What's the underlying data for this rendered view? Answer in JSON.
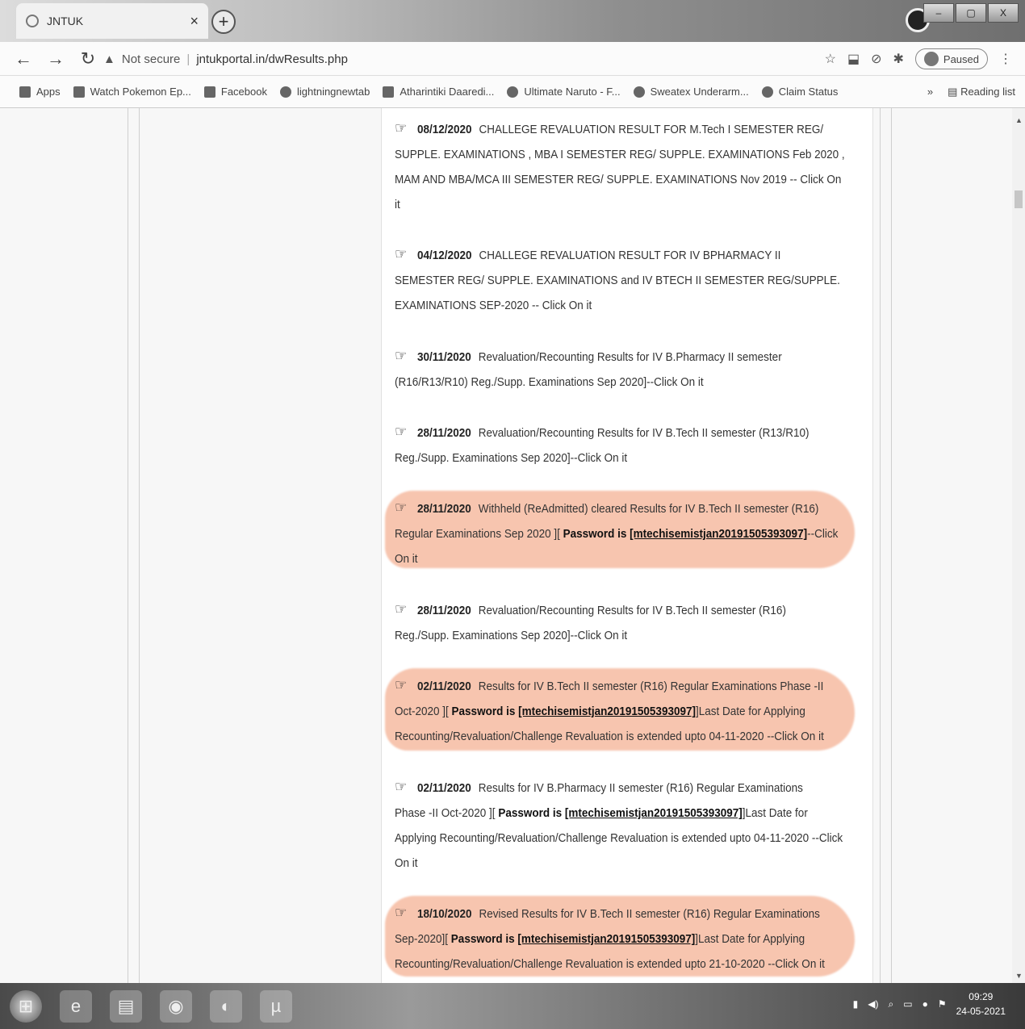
{
  "browser": {
    "tab_title": "JNTUK",
    "tab_close": "×",
    "new_tab": "+",
    "window_buttons": [
      "–",
      "▢",
      "X"
    ],
    "address_warning": "Not secure",
    "url": "jntukportal.in/dwResults.php",
    "profile_status": "Paused",
    "menu": "⋮"
  },
  "bookmarks": {
    "items": [
      {
        "label": "Apps",
        "icon": "apps-grid-icon"
      },
      {
        "label": "Watch Pokemon Ep...",
        "icon": "site-icon"
      },
      {
        "label": "Facebook",
        "icon": "facebook-icon"
      },
      {
        "label": "lightningnewtab",
        "icon": "globe-icon"
      },
      {
        "label": "Atharintiki Daaredi...",
        "icon": "site-icon"
      },
      {
        "label": "Ultimate Naruto - F...",
        "icon": "site-icon"
      },
      {
        "label": "Sweatex Underarm...",
        "icon": "globe-icon"
      },
      {
        "label": "Claim Status",
        "icon": "globe-icon"
      }
    ],
    "overflow": "»",
    "reading_list": "Reading list"
  },
  "results": [
    {
      "date": "08/12/2020",
      "text_lines": [
        "CHALLEGE REVALUATION RESULT FOR M.Tech I SEMESTER REG/",
        "SUPPLE. EXAMINATIONS , MBA I SEMESTER REG/ SUPPLE. EXAMINATIONS Feb 2020 ,",
        "MAM AND MBA/MCA III SEMESTER REG/ SUPPLE. EXAMINATIONS Nov 2019 -- Click On",
        "it"
      ]
    },
    {
      "date": "04/12/2020",
      "text_lines": [
        "CHALLEGE REVALUATION RESULT FOR IV BPHARMACY II",
        "SEMESTER REG/ SUPPLE. EXAMINATIONS and IV BTECH II SEMESTER REG/SUPPLE.",
        "EXAMINATIONS SEP-2020 -- Click On it"
      ]
    },
    {
      "date": "30/11/2020",
      "text_lines": [
        "Revaluation/Recounting Results for IV B.Pharmacy II semester",
        "(R16/R13/R10) Reg./Supp. Examinations Sep 2020]--Click On it"
      ]
    },
    {
      "date": "28/11/2020",
      "text_lines": [
        "Revaluation/Recounting Results for IV B.Tech II semester (R13/R10)",
        "Reg./Supp. Examinations Sep 2020]--Click On it"
      ]
    },
    {
      "date": "28/11/2020",
      "line1": "Withheld (ReAdmitted) cleared Results for IV B.Tech II semester (R16)",
      "line2_pre": "Regular Examinations Sep 2020 ][ ",
      "pw_label": "Password is ",
      "pw_value": "[mtechisemistjan20191505393097]",
      "line2_post": "--Click",
      "line3": "On it"
    },
    {
      "date": "28/11/2020",
      "text_lines": [
        "Revaluation/Recounting Results for IV B.Tech II semester (R16)",
        "Reg./Supp. Examinations Sep 2020]--Click On it"
      ]
    },
    {
      "date": "02/11/2020",
      "line1": "Results for IV B.Tech II semester (R16) Regular Examinations Phase -II",
      "line2_pre": "Oct-2020 ][ ",
      "pw_label": "Password is ",
      "pw_value": "[mtechisemistjan20191505393097]",
      "line2_post": "]Last Date for Applying",
      "line3": "Recounting/Revaluation/Challenge Revaluation is extended upto 04-11-2020 --Click On it"
    },
    {
      "date": "02/11/2020",
      "line1": "Results for IV B.Pharmacy II semester (R16) Regular Examinations",
      "line2_pre": "Phase -II Oct-2020 ][ ",
      "pw_label": "Password is ",
      "pw_value": "[mtechisemistjan20191505393097]",
      "line2_post": "]Last Date for",
      "line3": "Applying Recounting/Revaluation/Challenge Revaluation is extended upto 04-11-2020 --Click",
      "line4": "On it"
    },
    {
      "date": "18/10/2020",
      "line1": "Revised Results for IV B.Tech II semester (R16) Regular Examinations",
      "line2_pre": "Sep-2020][ ",
      "pw_label": "Password is ",
      "pw_value": "[mtechisemistjan20191505393097]",
      "line2_post": "]Last Date for Applying",
      "line3": "Recounting/Revaluation/Challenge Revaluation is extended upto 21-10-2020 --Click On it"
    }
  ],
  "taskbar": {
    "clock_time": "09:29",
    "clock_date": "24-05-2021"
  },
  "colors": {
    "highlight": "#f0966e",
    "page_bg": "#f7f7f7"
  }
}
